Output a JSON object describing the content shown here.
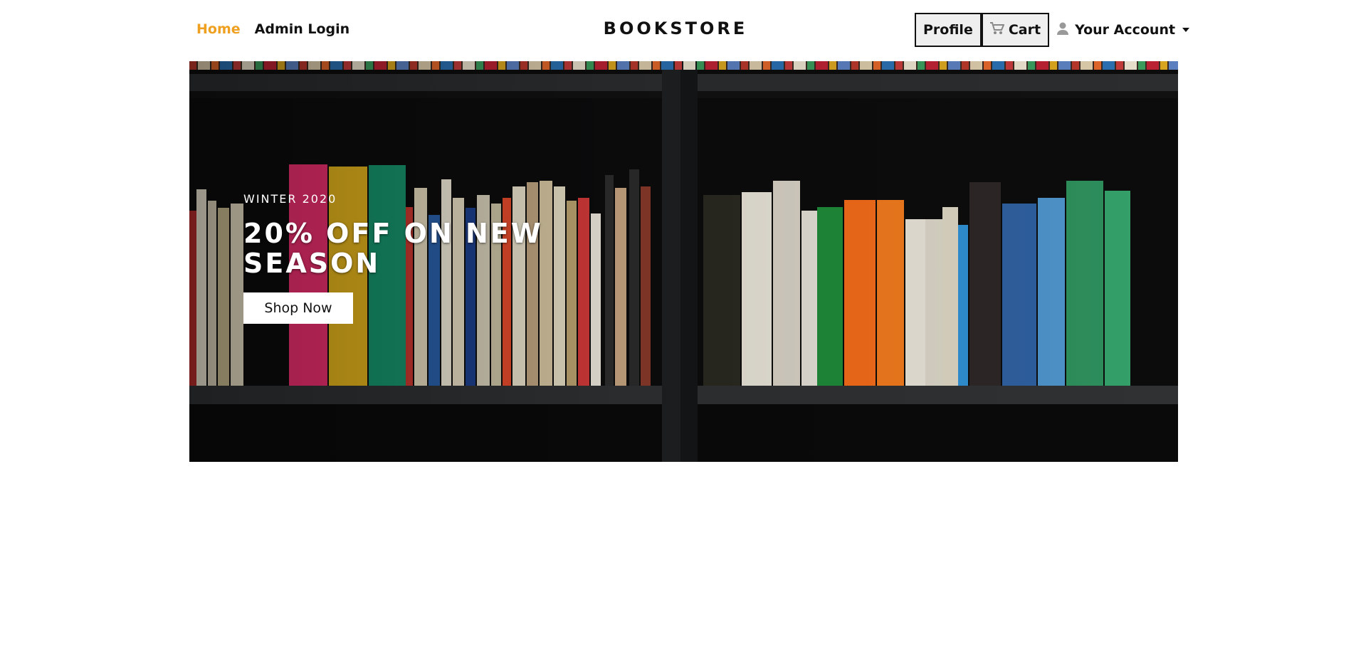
{
  "nav": {
    "home": "Home",
    "admin_login": "Admin Login",
    "brand": "BOOKSTORE",
    "profile": "Profile",
    "cart": "Cart",
    "account": "Your Account",
    "home_color": "#f0a020"
  },
  "hero": {
    "season": "WINTER 2020",
    "headline": "20% OFF ON NEW SEASON",
    "cta": "Shop Now"
  },
  "icons": {
    "cart": "cart-icon",
    "user": "user-icon",
    "dropdown": "chevron-down-icon"
  }
}
